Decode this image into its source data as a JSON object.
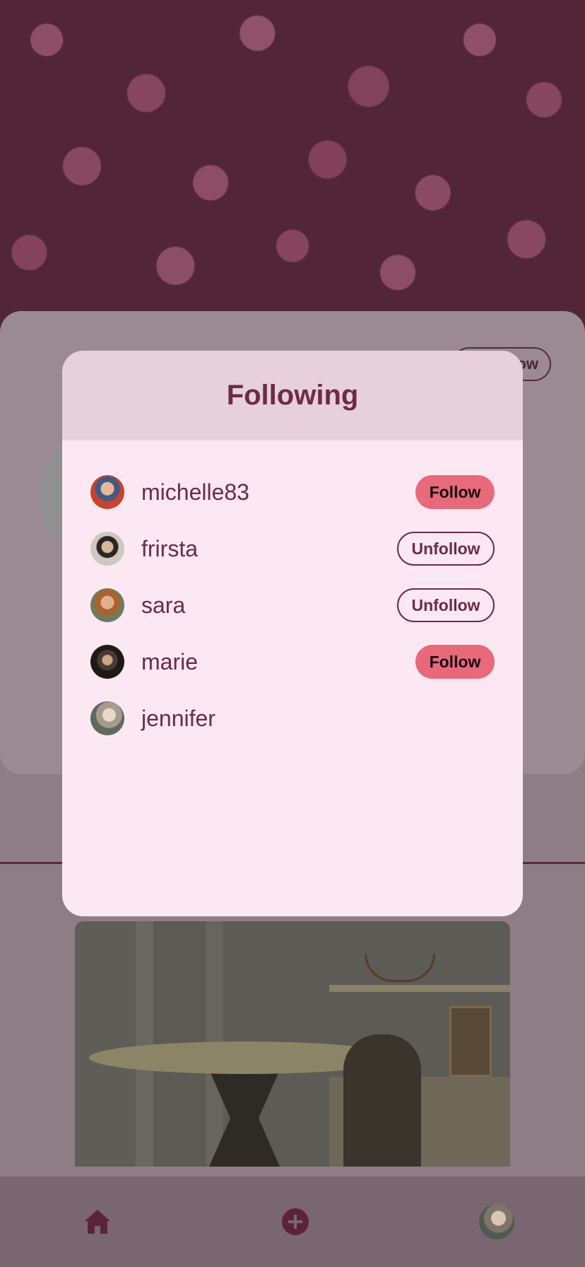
{
  "background": {
    "profile_button_label": "Follow"
  },
  "modal": {
    "title": "Following",
    "users": [
      {
        "username": "michelle83",
        "action": "Follow"
      },
      {
        "username": "frirsta",
        "action": "Unfollow"
      },
      {
        "username": "sara",
        "action": "Unfollow"
      },
      {
        "username": "marie",
        "action": "Follow"
      },
      {
        "username": "jennifer",
        "action": ""
      }
    ]
  },
  "nav": {
    "items": [
      "home-icon",
      "add-icon",
      "profile-avatar"
    ]
  },
  "colors": {
    "accent": "#e8697a",
    "text_primary": "#6e2c43",
    "modal_bg": "#fbe8f2",
    "modal_header_bg": "#e6d0db"
  }
}
